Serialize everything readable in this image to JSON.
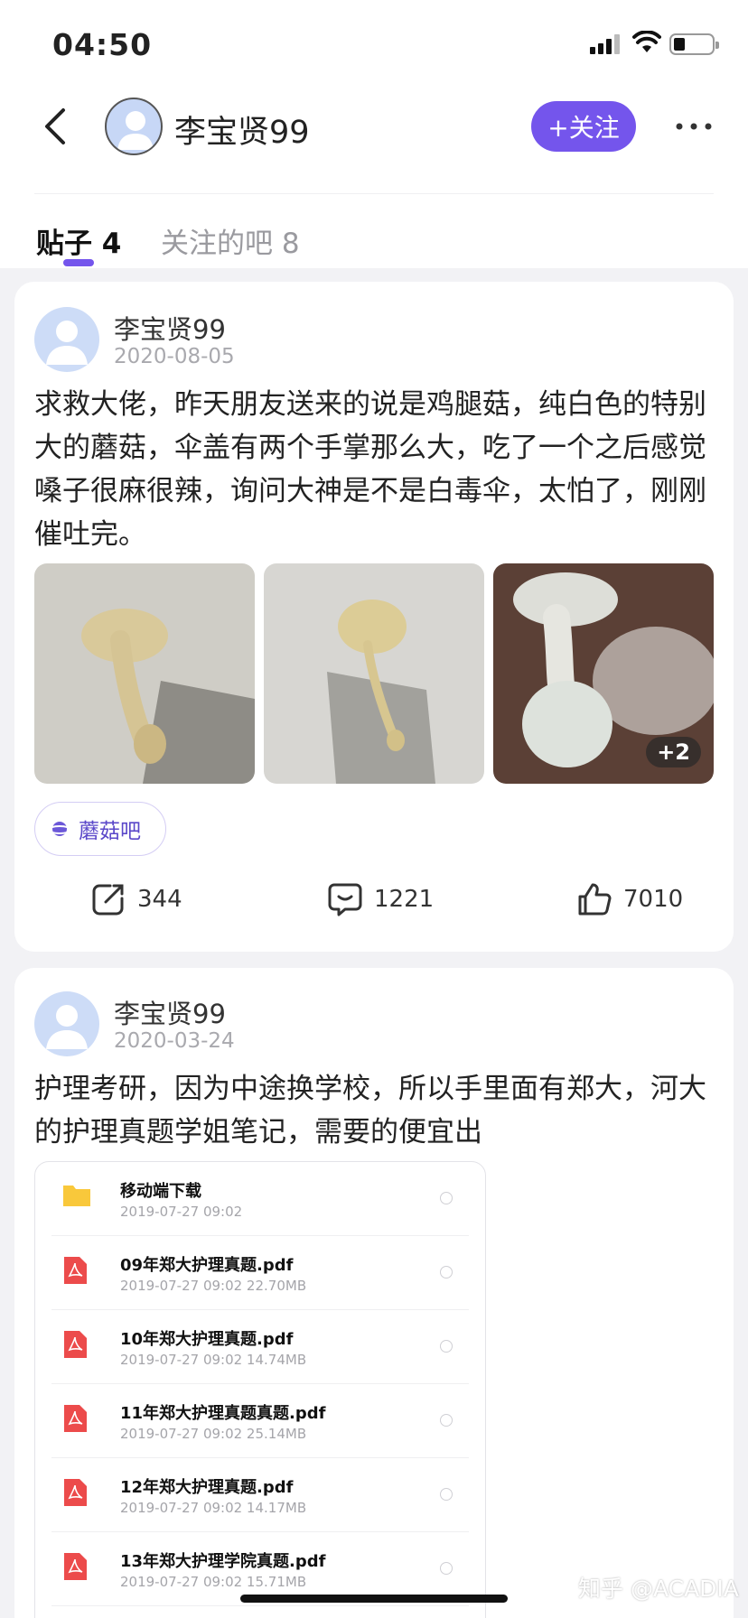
{
  "status_bar": {
    "time": "04:50"
  },
  "header": {
    "username": "李宝贤99",
    "follow_label": "+关注"
  },
  "tabs": [
    {
      "label": "贴子 4"
    },
    {
      "label": "关注的吧 8"
    }
  ],
  "posts": [
    {
      "author": "李宝贤99",
      "date": "2020-08-05",
      "text": "求救大佬，昨天朋友送来的说是鸡腿菇，纯白色的特别大的蘑菇，伞盖有两个手掌那么大，吃了一个之后感觉嗓子很麻很辣，询问大神是不是白毒伞，太怕了，刚刚催吐完。",
      "more_images": "+2",
      "bar_tag": "蘑菇吧",
      "actions": {
        "shares": "344",
        "comments": "1221",
        "likes": "7010"
      }
    },
    {
      "author": "李宝贤99",
      "date": "2020-03-24",
      "text": "护理考研，因为中途换学校，所以手里面有郑大，河大的护理真题学姐笔记，需要的便宜出",
      "files": [
        {
          "name": "移动端下载",
          "meta": "2019-07-27  09:02",
          "icon": "folder-icon"
        },
        {
          "name": "09年郑大护理真题.pdf",
          "meta": "2019-07-27  09:02  22.70MB",
          "icon": "pdf-icon"
        },
        {
          "name": "10年郑大护理真题.pdf",
          "meta": "2019-07-27  09:02  14.74MB",
          "icon": "pdf-icon"
        },
        {
          "name": "11年郑大护理真题真题.pdf",
          "meta": "2019-07-27  09:02  25.14MB",
          "icon": "pdf-icon"
        },
        {
          "name": "12年郑大护理真题.pdf",
          "meta": "2019-07-27  09:02  14.17MB",
          "icon": "pdf-icon"
        },
        {
          "name": "13年郑大护理学院真题.pdf",
          "meta": "2019-07-27  09:02  15.71MB",
          "icon": "pdf-icon"
        }
      ]
    }
  ],
  "watermark": "知乎 @ACADIA",
  "colors": {
    "accent": "#7455ec",
    "folder": "#f9c83b",
    "pdf": "#ec4b4b"
  }
}
